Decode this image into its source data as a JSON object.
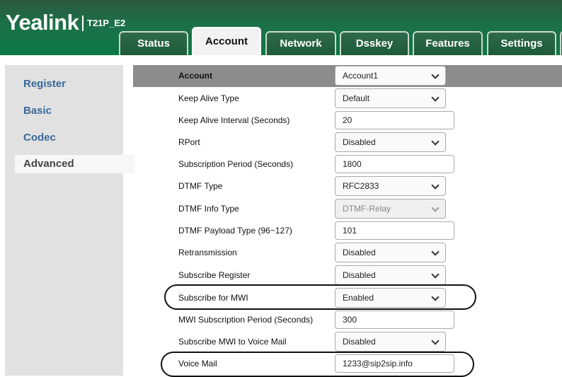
{
  "header": {
    "logo": "Yealink",
    "model": "T21P_E2",
    "tabs": [
      {
        "label": "Status"
      },
      {
        "label": "Account"
      },
      {
        "label": "Network"
      },
      {
        "label": "Dsskey"
      },
      {
        "label": "Features"
      },
      {
        "label": "Settings"
      }
    ],
    "active_tab": "Account"
  },
  "sidebar": {
    "items": [
      {
        "label": "Register"
      },
      {
        "label": "Basic"
      },
      {
        "label": "Codec"
      },
      {
        "label": "Advanced"
      }
    ],
    "active": "Advanced"
  },
  "form": {
    "account": {
      "label": "Account",
      "value": "Account1"
    },
    "keep_alive_type": {
      "label": "Keep Alive Type",
      "value": "Default"
    },
    "keep_alive_interval": {
      "label": "Keep Alive Interval (Seconds)",
      "value": "20"
    },
    "rport": {
      "label": "RPort",
      "value": "Disabled"
    },
    "subscription_period": {
      "label": "Subscription Period (Seconds)",
      "value": "1800"
    },
    "dtmf_type": {
      "label": "DTMF Type",
      "value": "RFC2833"
    },
    "dtmf_info_type": {
      "label": "DTMF Info Type",
      "value": "DTMF-Relay"
    },
    "dtmf_payload_type": {
      "label": "DTMF Payload Type (96~127)",
      "value": "101"
    },
    "retransmission": {
      "label": "Retransmission",
      "value": "Disabled"
    },
    "subscribe_register": {
      "label": "Subscribe Register",
      "value": "Disabled"
    },
    "subscribe_mwi": {
      "label": "Subscribe for MWI",
      "value": "Enabled"
    },
    "mwi_subscription_period": {
      "label": "MWI Subscription Period (Seconds)",
      "value": "300"
    },
    "subscribe_mwi_voicemail": {
      "label": "Subscribe MWI to Voice Mail",
      "value": "Disabled"
    },
    "voice_mail": {
      "label": "Voice Mail",
      "value": "1233@sip2sip.info"
    }
  }
}
